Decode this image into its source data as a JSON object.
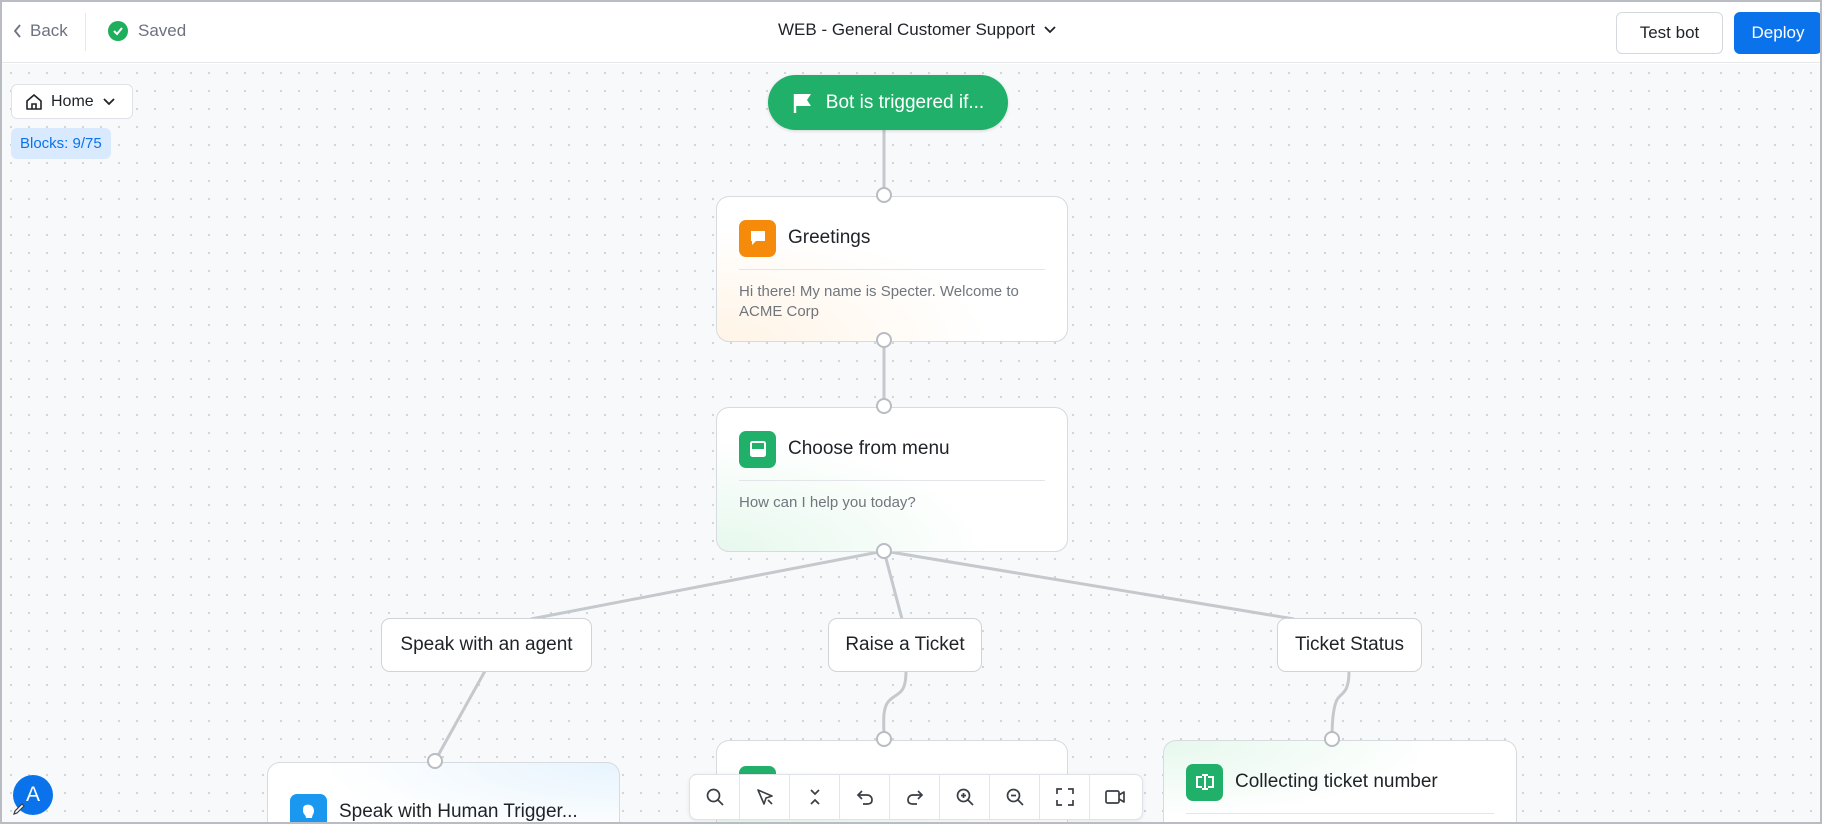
{
  "header": {
    "back_label": "Back",
    "saved_label": "Saved",
    "bot_title": "WEB - General Customer Support",
    "test_label": "Test bot",
    "deploy_label": "Deploy"
  },
  "canvas": {
    "home_label": "Home",
    "blocks_label": "Blocks: 9/75"
  },
  "trigger": {
    "label": "Bot is triggered if..."
  },
  "nodes": {
    "greetings": {
      "title": "Greetings",
      "body": "Hi there! My name is Specter. Welcome to ACME Corp",
      "icon": "chat-bubble-icon",
      "color": "#f58a0b"
    },
    "menu": {
      "title": "Choose from menu",
      "body": "How can I help you today?",
      "icon": "menu-card-icon",
      "color": "#21b06a"
    },
    "human": {
      "title": "Speak with Human Trigger...",
      "icon": "speaking-head-icon",
      "color": "#1a98f0"
    },
    "collect": {
      "title": "Collecting ticket number",
      "icon": "text-cursor-icon",
      "color": "#21b06a"
    }
  },
  "options": {
    "agent": "Speak with an agent",
    "raise": "Raise a Ticket",
    "status": "Ticket Status"
  },
  "toolbar": {
    "tools": [
      "search-icon",
      "magic-select-icon",
      "collapse-icon",
      "undo-icon",
      "redo-icon",
      "zoom-in-icon",
      "zoom-out-icon",
      "fit-screen-icon",
      "video-icon"
    ]
  },
  "user": {
    "avatar_initial": "A"
  },
  "colors": {
    "accent": "#0a73eb",
    "success": "#21b06a",
    "warning": "#f58a0b"
  }
}
